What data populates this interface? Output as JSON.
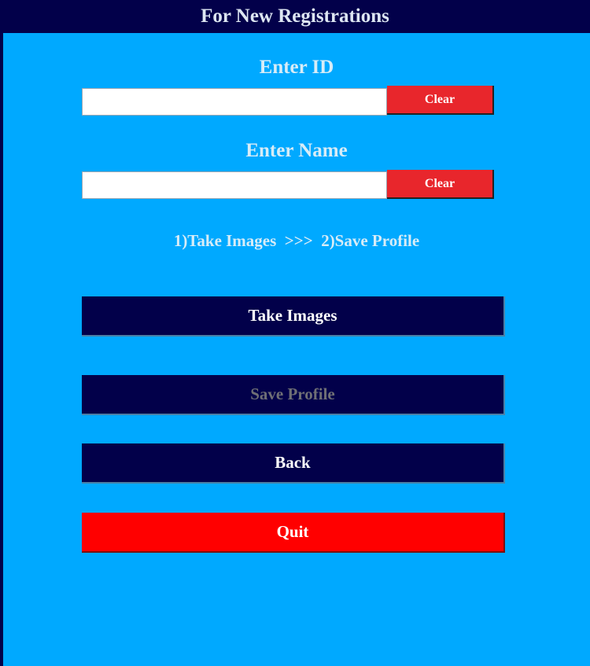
{
  "header": {
    "title": "For New Registrations"
  },
  "form": {
    "id_label": "Enter ID",
    "id_value": "",
    "name_label": "Enter Name",
    "name_value": "",
    "clear_label": "Clear"
  },
  "instructions": "1)Take Images  >>>  2)Save Profile",
  "buttons": {
    "take_images": "Take Images",
    "save_profile": "Save Profile",
    "back": "Back",
    "quit": "Quit"
  },
  "colors": {
    "background": "#00a9ff",
    "header": "#02004a",
    "button": "#02004a",
    "clear": "#e8262c",
    "quit": "#ff0000"
  }
}
